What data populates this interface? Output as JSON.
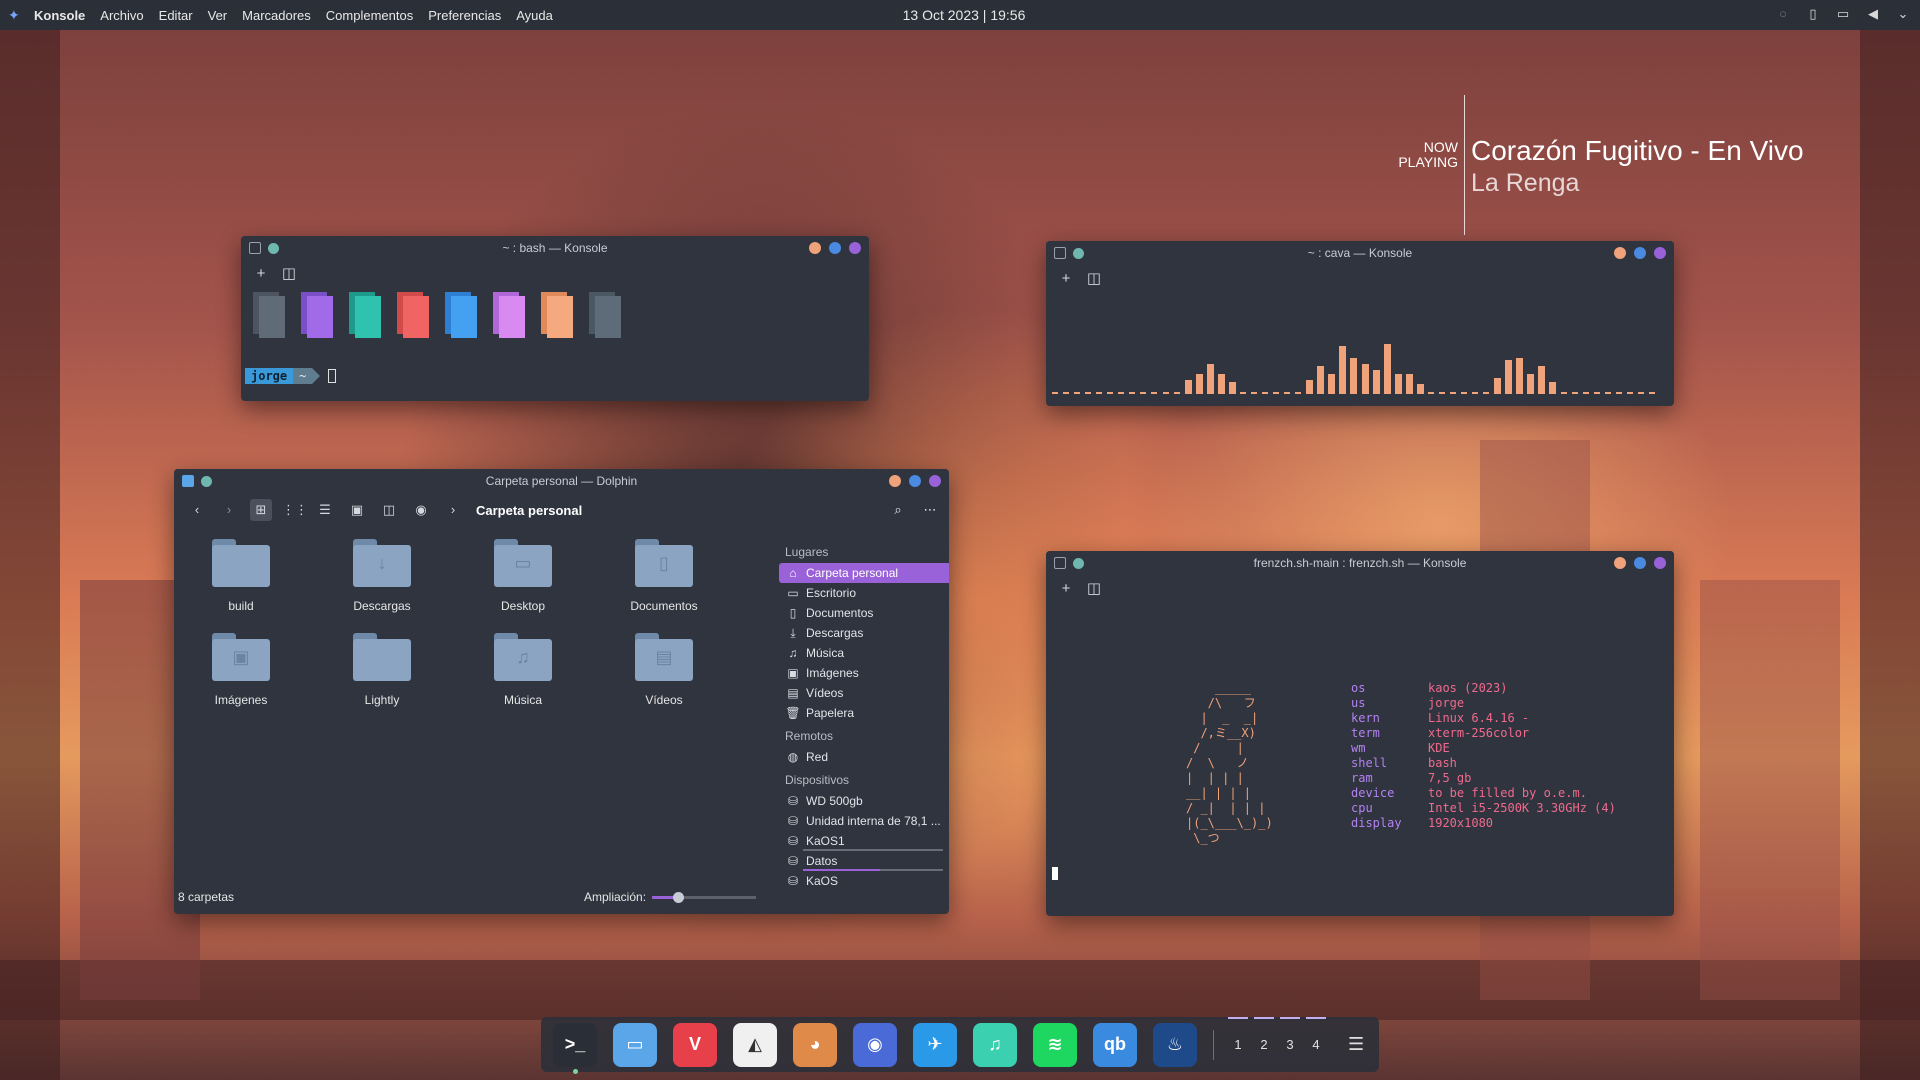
{
  "top_panel": {
    "menu": [
      "Konsole",
      "Archivo",
      "Editar",
      "Ver",
      "Marcadores",
      "Complementos",
      "Preferencias",
      "Ayuda"
    ],
    "clock": "13 Oct 2023 | 19:56",
    "tray_icons": [
      "hidden-icon",
      "battery-icon",
      "network-icon",
      "volume-icon",
      "chevron-down-icon"
    ]
  },
  "now_playing": {
    "label_line1": "NOW",
    "label_line2": "PLAYING",
    "title": "Corazón Fugitivo - En Vivo",
    "artist": "La Renga"
  },
  "bash_window": {
    "title": "~ : bash — Konsole",
    "swatch_colors": [
      {
        "back": "#4c5561",
        "front": "#606b78"
      },
      {
        "back": "#7a4fc8",
        "front": "#a06ae8"
      },
      {
        "back": "#1e9a8c",
        "front": "#2fc2ae"
      },
      {
        "back": "#d24a4a",
        "front": "#f06464"
      },
      {
        "back": "#2c7fd2",
        "front": "#44a0f0"
      },
      {
        "back": "#b068d8",
        "front": "#d88af0"
      },
      {
        "back": "#e08a5a",
        "front": "#f4aa7e"
      },
      {
        "back": "#4a5864",
        "front": "#5d6c78"
      }
    ],
    "prompt_user": "jorge",
    "prompt_dir": "~"
  },
  "cava_window": {
    "title": "~ : cava — Konsole",
    "bars": [
      0,
      0,
      0,
      0,
      0,
      0,
      0,
      0,
      0,
      0,
      0,
      0,
      14,
      20,
      30,
      20,
      12,
      0,
      0,
      0,
      0,
      0,
      0,
      14,
      28,
      20,
      48,
      36,
      30,
      24,
      50,
      20,
      20,
      10,
      0,
      0,
      0,
      0,
      0,
      0,
      16,
      34,
      36,
      20,
      28,
      12,
      0,
      0,
      0,
      0,
      0,
      0,
      0,
      0,
      0
    ]
  },
  "dolphin_window": {
    "title": "Carpeta personal — Dolphin",
    "breadcrumb": "Carpeta personal",
    "files": [
      {
        "name": "build",
        "glyph": ""
      },
      {
        "name": "Descargas",
        "glyph": "↓"
      },
      {
        "name": "Desktop",
        "glyph": "▭"
      },
      {
        "name": "Documentos",
        "glyph": "▯"
      },
      {
        "name": "Imágenes",
        "glyph": "▣"
      },
      {
        "name": "Lightly",
        "glyph": ""
      },
      {
        "name": "Música",
        "glyph": "♫"
      },
      {
        "name": "Vídeos",
        "glyph": "▤"
      }
    ],
    "sidebar": {
      "places_label": "Lugares",
      "places": [
        {
          "label": "Carpeta personal",
          "icon": "home-icon",
          "glyph": "⌂"
        },
        {
          "label": "Escritorio",
          "icon": "desktop-icon",
          "glyph": "▭"
        },
        {
          "label": "Documentos",
          "icon": "documents-icon",
          "glyph": "▯"
        },
        {
          "label": "Descargas",
          "icon": "downloads-icon",
          "glyph": "⤓"
        },
        {
          "label": "Música",
          "icon": "music-icon",
          "glyph": "♫"
        },
        {
          "label": "Imágenes",
          "icon": "images-icon",
          "glyph": "▣"
        },
        {
          "label": "Vídeos",
          "icon": "videos-icon",
          "glyph": "▤"
        },
        {
          "label": "Papelera",
          "icon": "trash-icon",
          "glyph": "🗑"
        }
      ],
      "remote_label": "Remotos",
      "remote": [
        {
          "label": "Red",
          "icon": "network-icon",
          "glyph": "◍"
        }
      ],
      "devices_label": "Dispositivos",
      "devices": [
        {
          "label": "WD 500gb",
          "icon": "drive-icon",
          "glyph": "⛁",
          "usage": null
        },
        {
          "label": "Unidad interna de 78,1 ...",
          "icon": "drive-icon",
          "glyph": "⛁",
          "usage": null
        },
        {
          "label": "KaOS1",
          "icon": "drive-icon",
          "glyph": "⛁",
          "usage": 0.0
        },
        {
          "label": "Datos",
          "icon": "drive-icon",
          "glyph": "⛁",
          "usage": 0.55
        },
        {
          "label": "KaOS",
          "icon": "drive-icon",
          "glyph": "⛁",
          "usage": null
        }
      ]
    },
    "status": "8 carpetas",
    "zoom_label": "Ampliación:",
    "zoom_value": 0.25
  },
  "frenzch_window": {
    "title": "frenzch.sh-main : frenzch.sh — Konsole",
    "ascii": "    _____\n   /\\   フ\n  |  _  _|\n  /,ミ__X)\n /     |\n/  \\   ノ\n|  | | |\n__| | | |\n/ _|  | | |\n|(_\\___\\_)_)\n \\_つ",
    "info": [
      {
        "k": "os",
        "v": "kaos (2023)"
      },
      {
        "k": "us",
        "v": "jorge"
      },
      {
        "k": "kern",
        "v": "Linux 6.4.16 -"
      },
      {
        "k": "term",
        "v": "xterm-256color"
      },
      {
        "k": "wm",
        "v": "KDE"
      },
      {
        "k": "shell",
        "v": "bash"
      },
      {
        "k": "ram",
        "v": "7,5 gb"
      },
      {
        "k": "device",
        "v": "to be filled by o.e.m."
      },
      {
        "k": "cpu",
        "v": "Intel i5-2500K 3.30GHz (4)"
      },
      {
        "k": "display",
        "v": "1920x1080"
      }
    ]
  },
  "dock": {
    "apps": [
      {
        "name": "konsole",
        "glyph": ">_",
        "color": "#2a2e36"
      },
      {
        "name": "dolphin",
        "glyph": "▭",
        "color": "#5aa6e8"
      },
      {
        "name": "vivaldi",
        "glyph": "V",
        "color": "#e8404a"
      },
      {
        "name": "inkscape",
        "glyph": "◭",
        "color": "#f0f0f0"
      },
      {
        "name": "gimp",
        "glyph": "◕",
        "color": "#e08a4a"
      },
      {
        "name": "app-blue",
        "glyph": "◉",
        "color": "#4a6ad8"
      },
      {
        "name": "kdeconnect",
        "glyph": "✈",
        "color": "#2a9ae8"
      },
      {
        "name": "music",
        "glyph": "♫",
        "color": "#3ad0b0"
      },
      {
        "name": "spotify",
        "glyph": "≋",
        "color": "#1ed760"
      },
      {
        "name": "qbittorrent",
        "glyph": "qb",
        "color": "#3a8ae0"
      },
      {
        "name": "steam",
        "glyph": "♨",
        "color": "#1e4a8a"
      }
    ],
    "pager": [
      "1",
      "2",
      "3",
      "4"
    ]
  }
}
